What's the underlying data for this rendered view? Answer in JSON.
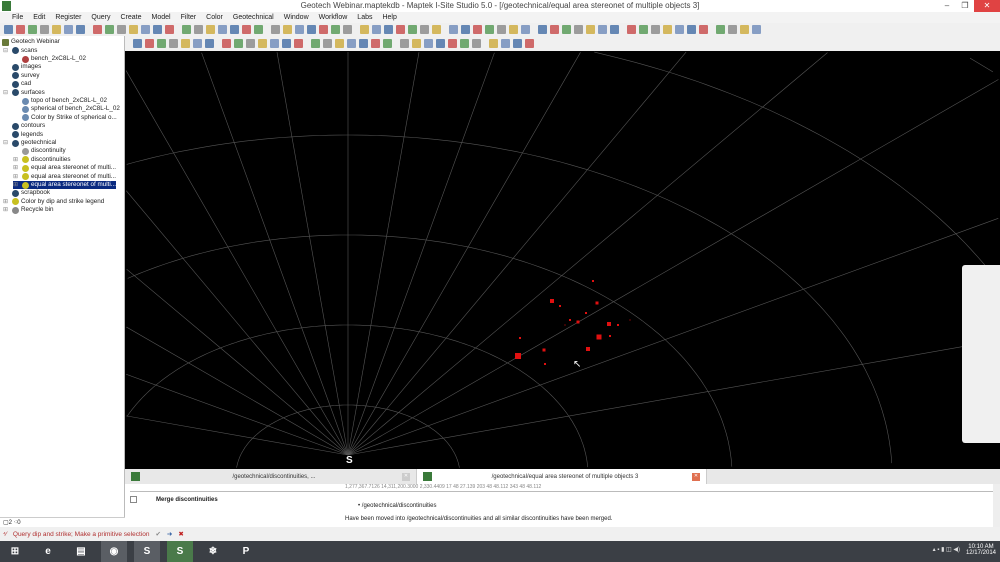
{
  "window": {
    "title": "Geotech Webinar.maptekdb - Maptek I-Site Studio 5.0 - [/geotechnical/equal area stereonet of multiple objects 3]",
    "minimize": "–",
    "restore": "❐",
    "close": "✕"
  },
  "menu": [
    "File",
    "Edit",
    "Register",
    "Query",
    "Create",
    "Model",
    "Filter",
    "Color",
    "Geotechnical",
    "Window",
    "Workflow",
    "Labs",
    "Help"
  ],
  "tree": {
    "root": "Geotech Webinar",
    "nodes": [
      {
        "label": "scans",
        "depth": 1,
        "exp": "⊟",
        "color": "#2a4a6a"
      },
      {
        "label": "bench_2xC8L-L_02",
        "depth": 2,
        "exp": "",
        "color": "#b04040"
      },
      {
        "label": "images",
        "depth": 1,
        "exp": "",
        "color": "#2a4a6a"
      },
      {
        "label": "survey",
        "depth": 1,
        "exp": "",
        "color": "#2a4a6a"
      },
      {
        "label": "cad",
        "depth": 1,
        "exp": "",
        "color": "#2a4a6a"
      },
      {
        "label": "surfaces",
        "depth": 1,
        "exp": "⊟",
        "color": "#2a4a6a"
      },
      {
        "label": "topo of bench_2xC8L-L_02",
        "depth": 2,
        "exp": "",
        "color": "#6a8ab0"
      },
      {
        "label": "spherical of bench_2xC8L-L_02",
        "depth": 2,
        "exp": "",
        "color": "#6a8ab0"
      },
      {
        "label": "Color by Strike of  spherical o...",
        "depth": 2,
        "exp": "",
        "color": "#6a8ab0"
      },
      {
        "label": "contours",
        "depth": 1,
        "exp": "",
        "color": "#2a4a6a"
      },
      {
        "label": "legends",
        "depth": 1,
        "exp": "",
        "color": "#2a4a6a"
      },
      {
        "label": "geotechnical",
        "depth": 1,
        "exp": "⊟",
        "color": "#2a4a6a"
      },
      {
        "label": "discontinuity",
        "depth": 2,
        "exp": "",
        "color": "#999999"
      },
      {
        "label": "discontinuities",
        "depth": 2,
        "exp": "⊞",
        "color": "#c8c020"
      },
      {
        "label": "equal area stereonet of multi...",
        "depth": 2,
        "exp": "⊞",
        "color": "#c8c020"
      },
      {
        "label": "equal area stereonet of multi...",
        "depth": 2,
        "exp": "⊞",
        "color": "#c8c020"
      },
      {
        "label": "equal area stereonet of multi...",
        "depth": 2,
        "exp": "⊞",
        "color": "#c8c020",
        "selected": true
      },
      {
        "label": "scrapbook",
        "depth": 1,
        "exp": "",
        "color": "#2a4a6a"
      },
      {
        "label": "Color by dip and strike legend",
        "depth": 1,
        "exp": "⊞",
        "color": "#c8c020"
      },
      {
        "label": "Recycle bin",
        "depth": 1,
        "exp": "⊞",
        "color": "#888888"
      }
    ],
    "footer": "▢2  ⁖0"
  },
  "viewport": {
    "compass_label": "S",
    "points": [
      [
        593,
        281,
        2
      ],
      [
        552,
        301,
        4
      ],
      [
        560,
        306,
        2
      ],
      [
        597,
        303,
        3
      ],
      [
        586,
        313,
        2
      ],
      [
        570,
        320,
        2
      ],
      [
        578,
        322,
        3
      ],
      [
        609,
        324,
        4
      ],
      [
        618,
        325,
        2
      ],
      [
        599,
        337,
        5
      ],
      [
        520,
        338,
        2
      ],
      [
        544,
        350,
        3
      ],
      [
        588,
        349,
        4
      ],
      [
        518,
        356,
        6
      ],
      [
        545,
        364,
        2
      ],
      [
        610,
        336,
        2
      ],
      [
        630,
        320,
        1
      ],
      [
        565,
        325,
        1
      ]
    ]
  },
  "tabs": [
    {
      "label": "/geotechnical/discontinuities, ...",
      "close": "✕"
    },
    {
      "label": "/geotechnical/equal area stereonet of multiple objects 3",
      "close": "✕"
    }
  ],
  "report": {
    "truncated": "1,277,367.7126  14,311,200.3000  2,330.4409  17  48  27.139  203  48  48.112  343  48  48.112",
    "heading": "Merge discontinuities",
    "bullet": "/geotechnical/discontinuities",
    "text": "Have been moved into /geotechnical/discontinuities and all similar discontinuities have been merged."
  },
  "status": {
    "prompt": "Query dip and strike; Make a primitive selection",
    "accept": "✔",
    "next": "➜",
    "cancel": "✖"
  },
  "taskbar": {
    "apps": [
      {
        "name": "start",
        "glyph": "⊞",
        "bg": "#3b3f45"
      },
      {
        "name": "ie",
        "glyph": "e",
        "bg": "#3b3f45"
      },
      {
        "name": "explorer",
        "glyph": "▤",
        "bg": "#3b3f45"
      },
      {
        "name": "chrome",
        "glyph": "◉",
        "bg": "#5a5e64"
      },
      {
        "name": "skype",
        "glyph": "S",
        "bg": "#5a5e64"
      },
      {
        "name": "isite",
        "glyph": "S",
        "bg": "#4a7a4a"
      },
      {
        "name": "app",
        "glyph": "❄",
        "bg": "#3b3f45"
      },
      {
        "name": "powerpoint",
        "glyph": "P",
        "bg": "#3b3f45"
      }
    ],
    "time": "10:10 AM",
    "date": "12/17/2014",
    "tray": "▴  ▪  ▮  ◫  ◀)"
  }
}
